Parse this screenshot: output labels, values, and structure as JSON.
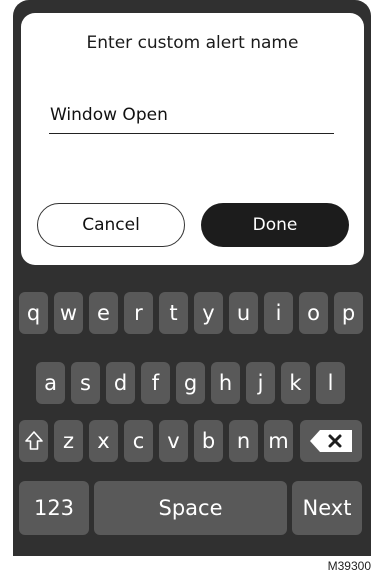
{
  "dialog": {
    "title": "Enter custom alert name",
    "field_value": "Window Open",
    "cancel_label": "Cancel",
    "done_label": "Done"
  },
  "keyboard": {
    "row1": [
      "q",
      "w",
      "e",
      "r",
      "t",
      "y",
      "u",
      "i",
      "o",
      "p"
    ],
    "row2": [
      "a",
      "s",
      "d",
      "f",
      "g",
      "h",
      "j",
      "k",
      "l"
    ],
    "row3": [
      "z",
      "x",
      "c",
      "v",
      "b",
      "n",
      "m"
    ],
    "shift_icon": "shift-icon",
    "backspace_icon": "backspace-icon",
    "numbers_label": "123",
    "space_label": "Space",
    "next_label": "Next"
  },
  "figure_id": "M39300"
}
